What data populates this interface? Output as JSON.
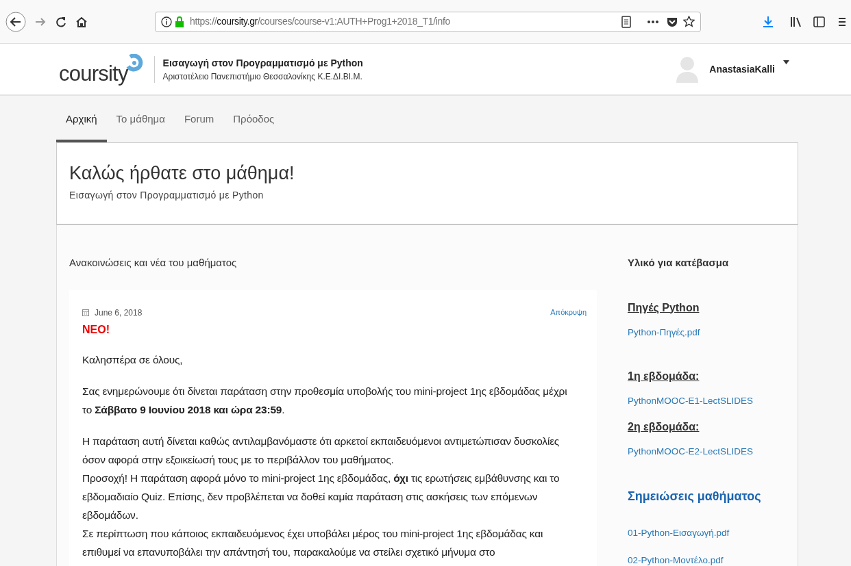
{
  "browser": {
    "url_scheme": "https://",
    "url_domain": "coursity.gr",
    "url_path": "/courses/course-v1:AUTH+Prog1+2018_T1/info"
  },
  "header": {
    "logo_text": "coursity",
    "course_title": "Εισαγωγή στον Προγραμματισμό με Python",
    "institution": "Αριστοτέλειο Πανεπιστήμιο Θεσσαλονίκης Κ.Ε.ΔΙ.ΒΙ.Μ.",
    "user_name": "AnastasiaKalli"
  },
  "tabs": [
    {
      "label": "Αρχική",
      "selected": true
    },
    {
      "label": "Το μάθημα",
      "selected": false
    },
    {
      "label": "Forum",
      "selected": false
    },
    {
      "label": "Πρόοδος",
      "selected": false
    }
  ],
  "hero": {
    "title": "Καλώς ήρθατε στο μάθημα!",
    "subtitle": "Εισαγωγή στον Προγραμματισμό με Python"
  },
  "announcements": {
    "heading": "Ανακοινώσεις και νέα του μαθήματος",
    "post": {
      "date": "June 6, 2018",
      "hide_link": "Απόκρυψη",
      "badge": "ΝΕΟ!",
      "blocks": [
        [
          "Καλησπέρα σε όλους,"
        ],
        [
          "Σας ενημερώνουμε ότι δίνεται παράταση στην προθεσμία υποβολής του mini-project 1ης εβδομάδας μέχρι το **Σάββατο 9 Ιουνίου 2018 και ώρα 23:59**."
        ],
        [
          "Η παράταση αυτή δίνεται καθώς αντιλαμβανόμαστε ότι αρκετοί εκπαιδευόμενοι αντιμετώπισαν δυσκολίες όσον αφορά στην εξοικείωσή τους με το περιβάλλον του μαθήματος.",
          "Προσοχή! Η παράταση αφορά μόνο το mini-project 1ης εβδομάδας, **όχι** τις ερωτήσεις εμβάθυνσης και το εβδομαδιαίο Quiz. Επίσης, δεν προβλέπεται να δοθεί καμία παράταση στις ασκήσεις των επόμενων εβδομάδων.",
          "Σε περίπτωση που κάποιος εκπαιδευόμενος έχει υποβάλει μέρος του mini-project 1ης εβδομάδας και επιθυμεί να επανυποβάλει την απάντησή του, παρακαλούμε να στείλει σχετικό μήνυμα στο"
        ]
      ]
    }
  },
  "sidebar": {
    "heading": "Υλικό για κατέβασμα",
    "sections": [
      {
        "kind": "underlined",
        "title": "Πηγές Python",
        "links": [
          "Python-Πηγές.pdf"
        ]
      },
      {
        "kind": "underlined",
        "title": "1η εβδομάδα:",
        "links": [
          "PythonMOOC-E1-LectSLIDES"
        ]
      },
      {
        "kind": "underlined",
        "title": "2η εβδομάδα:",
        "links": [
          "PythonMOOC-E2-LectSLIDES"
        ]
      },
      {
        "kind": "blue",
        "title": "Σημειώσεις μαθήματος",
        "links": [
          "01-Python-Εισαγωγή.pdf",
          "02-Python-Μοντέλο.pdf"
        ]
      }
    ]
  }
}
